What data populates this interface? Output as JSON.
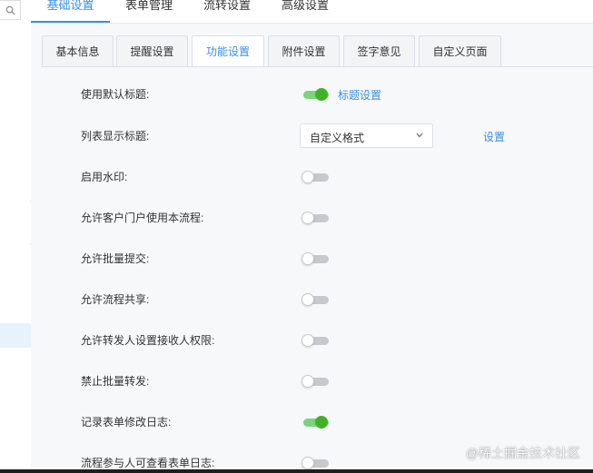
{
  "top_tabs": [
    "基础设置",
    "表单管理",
    "流转设置",
    "高级设置"
  ],
  "sub_tabs": [
    "基本信息",
    "提醒设置",
    "功能设置",
    "附件设置",
    "签字意见",
    "自定义页面"
  ],
  "rows": [
    {
      "label": "使用默认标题:",
      "state": "on"
    },
    {
      "label": "列表显示标题:",
      "state": "select"
    },
    {
      "label": "启用水印:",
      "state": "off"
    },
    {
      "label": "允许客户门户使用本流程:",
      "state": "off"
    },
    {
      "label": "允许批量提交:",
      "state": "off"
    },
    {
      "label": "允许流程共享:",
      "state": "off"
    },
    {
      "label": "允许转发人设置接收人权限:",
      "state": "off"
    },
    {
      "label": "禁止批量转发:",
      "state": "off"
    },
    {
      "label": "记录表单修改日志:",
      "state": "on"
    },
    {
      "label": "流程参与人可查看表单日志:",
      "state": "off"
    }
  ],
  "title_setting_link": "标题设置",
  "list_title_select": {
    "value": "自定义格式"
  },
  "list_title_setting_link": "设置",
  "watermark": "@稀土掘金技术社区",
  "colors": {
    "accent": "#3a8ee6",
    "toggle_on": "#43b02a",
    "toggle_off": "#c8c9cc"
  }
}
